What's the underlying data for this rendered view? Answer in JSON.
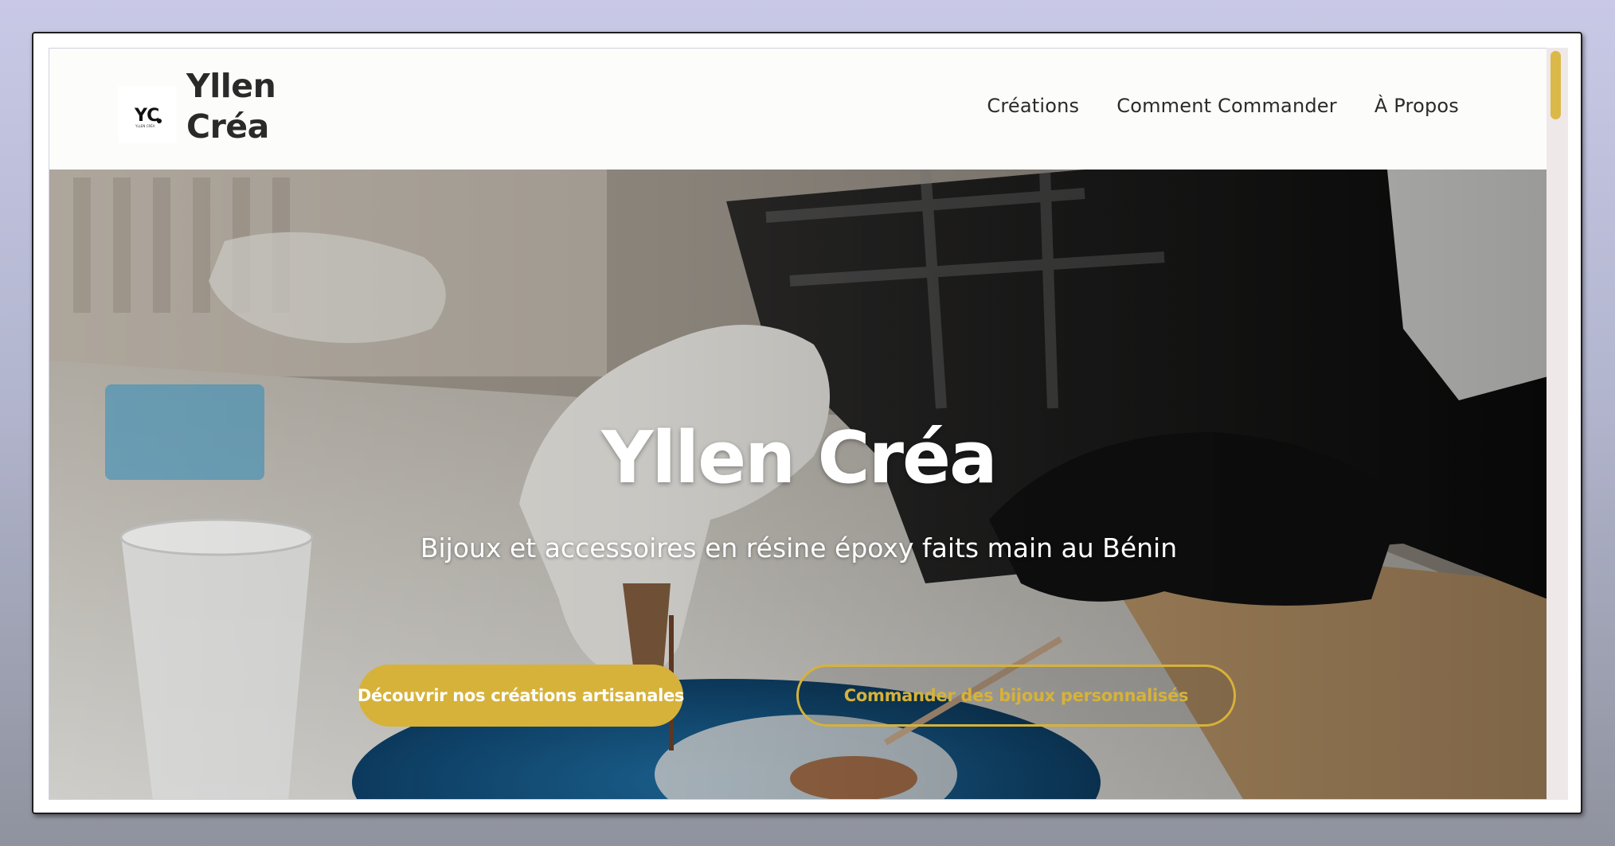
{
  "header": {
    "site_title_line1": "Yllen",
    "site_title_line2": "Créa",
    "logo_mark": "YC",
    "logo_caption": "YLLEN CRÉA",
    "nav": [
      {
        "label": "Créations"
      },
      {
        "label": "Comment Commander"
      },
      {
        "label": "À Propos"
      }
    ]
  },
  "hero": {
    "title": "Yllen Créa",
    "subtitle": "Bijoux et accessoires en résine époxy faits main au Bénin",
    "primary_button": "Découvrir nos créations artisanales",
    "secondary_button": "Commander des bijoux personnalisés",
    "background_description_icon": "resin-crafting-photo"
  },
  "colors": {
    "accent": "#d6b23a",
    "header_bg": "#fcfcfa",
    "title_text": "#2a2a2a",
    "scroll_thumb": "#dab949"
  }
}
